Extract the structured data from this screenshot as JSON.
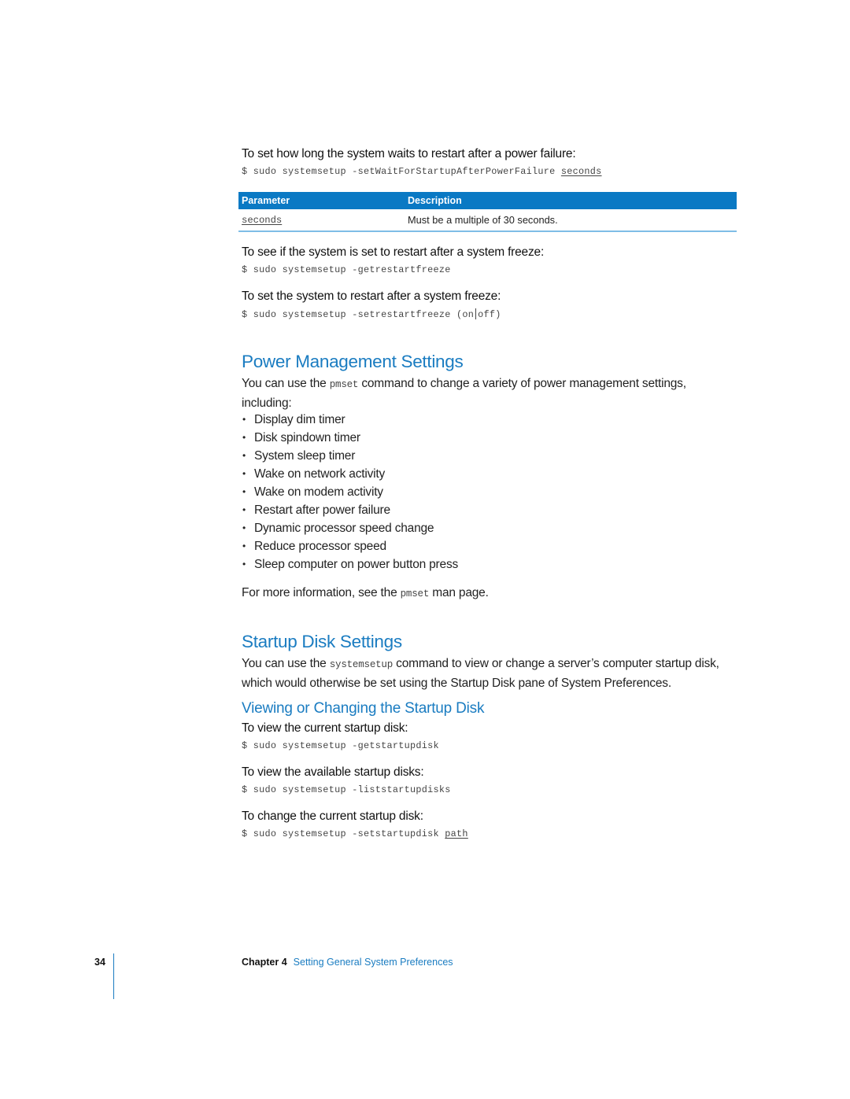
{
  "section_restart_power": {
    "task": "To set how long the system waits to restart after a power failure:",
    "command_prefix": "$ sudo systemsetup -setWaitForStartupAfterPowerFailure ",
    "command_arg": "seconds"
  },
  "param_table": {
    "headers": [
      "Parameter",
      "Description"
    ],
    "rows": [
      {
        "parameter": "seconds",
        "description": "Must be a multiple of 30 seconds."
      }
    ],
    "header_color": "#0a79c4"
  },
  "section_get_freeze": {
    "task": "To see if the system is set to restart after a system freeze:",
    "command": "$ sudo systemsetup -getrestartfreeze"
  },
  "section_set_freeze": {
    "task": "To set the system to restart after a system freeze:",
    "command_prefix": "$ sudo systemsetup -setrestartfreeze (on",
    "command_suffix": "off)"
  },
  "power_management": {
    "heading": "Power Management Settings",
    "intro_before": "You can use the ",
    "intro_code": "pmset",
    "intro_after": " command to change a variety of power management settings, including:",
    "items": [
      "Display dim timer",
      "Disk spindown timer",
      "System sleep timer",
      "Wake on network activity",
      "Wake on modem activity",
      "Restart after power failure",
      "Dynamic processor speed change",
      "Reduce processor speed",
      "Sleep computer on power button press"
    ],
    "bullet": "•",
    "more_before": "For more information, see the ",
    "more_code": "pmset",
    "more_after": " man page."
  },
  "startup_disk": {
    "heading": "Startup Disk Settings",
    "intro_before": "You can use the ",
    "intro_code": "systemsetup",
    "intro_after": " command to view or change a server’s computer startup disk, which would otherwise be set using the Startup Disk pane of System Preferences.",
    "subheading": "Viewing or Changing the Startup Disk",
    "tasks": [
      {
        "task": "To view the current startup disk:",
        "command": "$ sudo systemsetup -getstartupdisk"
      },
      {
        "task": "To view the available startup disks:",
        "command": "$ sudo systemsetup -liststartupdisks"
      },
      {
        "task": "To change the current startup disk:",
        "command_prefix": "$ sudo systemsetup -setstartupdisk ",
        "command_arg": "path"
      }
    ]
  },
  "footer": {
    "page_number": "34",
    "chapter_label": "Chapter 4",
    "chapter_title": "Setting General System Preferences"
  },
  "colors": {
    "heading_blue": "#1a7cc1",
    "table_header_blue": "#0a79c4",
    "table_rule_blue": "#7fbde6"
  }
}
